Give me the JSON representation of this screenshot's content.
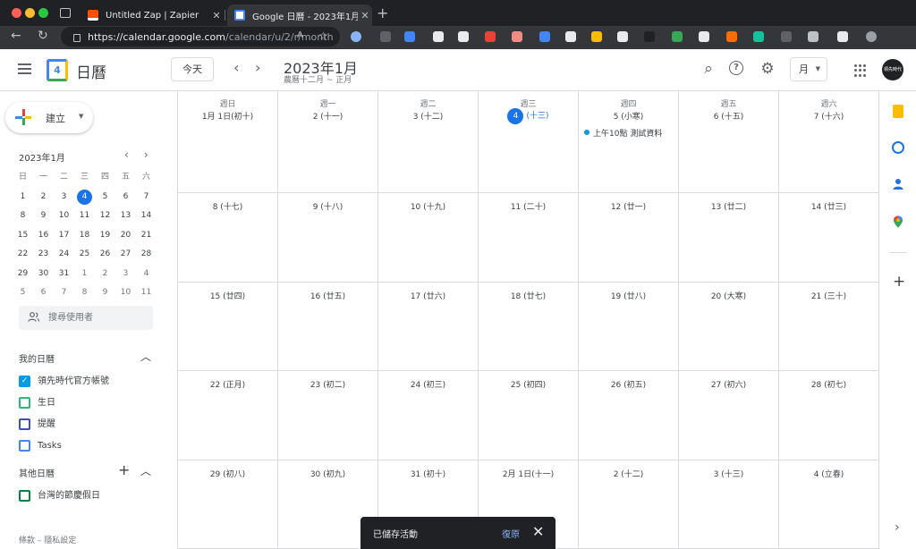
{
  "browser": {
    "tabs": [
      {
        "title": "Untitled Zap | Zapier",
        "active": false,
        "close": "✕"
      },
      {
        "title": "Google 日曆 - 2023年1月",
        "active": true,
        "close": "✕"
      }
    ],
    "new_tab": "+",
    "url_host": "https://calendar.google.com",
    "url_path": "/calendar/u/2/r/month",
    "nav": {
      "back": "←",
      "reload": "↻"
    },
    "omni_icons": {
      "read_aloud": "A",
      "favorite": "☆"
    },
    "extension_icons": [
      "profile-extension-icon",
      "extension-icon",
      "extension-icon",
      "notion-icon",
      "extension-icon",
      "extension-icon",
      "extension-icon",
      "translate-icon",
      "extension-icon",
      "extension-icon",
      "extension-icon",
      "extension-icon",
      "extension-icon",
      "extension-icon",
      "extension-icon",
      "grammarly-icon",
      "extension-icon",
      "puzzle-icon",
      "extension-icon",
      "profile-avatar"
    ]
  },
  "header": {
    "app_name": "日曆",
    "logo_num": "4",
    "today_btn": "今天",
    "prev": "‹",
    "next": "›",
    "month_title": "2023年1月",
    "lunar": "農曆十二月 ~ 正月",
    "view": "月",
    "avatar_text": "領先時代",
    "icons": {
      "search": "⌕",
      "help": "?",
      "settings": "⚙"
    }
  },
  "sidebar": {
    "create": "建立",
    "mini_month": "2023年1月",
    "mini_prev": "‹",
    "mini_next": "›",
    "weekdays": [
      "日",
      "一",
      "二",
      "三",
      "四",
      "五",
      "六"
    ],
    "mini_days": [
      {
        "d": "1",
        "o": false
      },
      {
        "d": "2",
        "o": false
      },
      {
        "d": "3",
        "o": false
      },
      {
        "d": "4",
        "o": false,
        "today": true
      },
      {
        "d": "5",
        "o": false
      },
      {
        "d": "6",
        "o": false
      },
      {
        "d": "7",
        "o": false
      },
      {
        "d": "8",
        "o": false
      },
      {
        "d": "9",
        "o": false
      },
      {
        "d": "10",
        "o": false
      },
      {
        "d": "11",
        "o": false
      },
      {
        "d": "12",
        "o": false
      },
      {
        "d": "13",
        "o": false
      },
      {
        "d": "14",
        "o": false
      },
      {
        "d": "15",
        "o": false
      },
      {
        "d": "16",
        "o": false
      },
      {
        "d": "17",
        "o": false
      },
      {
        "d": "18",
        "o": false
      },
      {
        "d": "19",
        "o": false
      },
      {
        "d": "20",
        "o": false
      },
      {
        "d": "21",
        "o": false
      },
      {
        "d": "22",
        "o": false
      },
      {
        "d": "23",
        "o": false
      },
      {
        "d": "24",
        "o": false
      },
      {
        "d": "25",
        "o": false
      },
      {
        "d": "26",
        "o": false
      },
      {
        "d": "27",
        "o": false
      },
      {
        "d": "28",
        "o": false
      },
      {
        "d": "29",
        "o": false
      },
      {
        "d": "30",
        "o": false
      },
      {
        "d": "31",
        "o": false
      },
      {
        "d": "1",
        "o": true
      },
      {
        "d": "2",
        "o": true
      },
      {
        "d": "3",
        "o": true
      },
      {
        "d": "4",
        "o": true
      },
      {
        "d": "5",
        "o": true
      },
      {
        "d": "6",
        "o": true
      },
      {
        "d": "7",
        "o": true
      },
      {
        "d": "8",
        "o": true
      },
      {
        "d": "9",
        "o": true
      },
      {
        "d": "10",
        "o": true
      },
      {
        "d": "11",
        "o": true
      }
    ],
    "search_people": "搜尋使用者",
    "my_calendars_title": "我的日曆",
    "my_calendars": [
      {
        "name": "領先時代官方帳號",
        "color": "#039be5",
        "checked": true
      },
      {
        "name": "生日",
        "color": "#33b679",
        "checked": false
      },
      {
        "name": "提醒",
        "color": "#3f51b5",
        "checked": false
      },
      {
        "name": "Tasks",
        "color": "#4285f4",
        "checked": false
      }
    ],
    "other_calendars_title": "其他日曆",
    "other_calendars": [
      {
        "name": "台灣的節慶假日",
        "color": "#0b8043",
        "checked": false
      }
    ],
    "footer": "條款 – 隱私設定"
  },
  "month": {
    "weekday_headers": [
      "週日",
      "週一",
      "週二",
      "週三",
      "週四",
      "週五",
      "週六"
    ],
    "weeks": [
      [
        {
          "label": "1月 1日(初十)"
        },
        {
          "label": "2 (十一)"
        },
        {
          "label": "3 (十二)"
        },
        {
          "day": "4",
          "lunar": "(十三)",
          "today": true
        },
        {
          "label": "5 (小寒)"
        },
        {
          "label": "6 (十五)"
        },
        {
          "label": "7 (十六)"
        }
      ],
      [
        {
          "label": "8 (十七)"
        },
        {
          "label": "9 (十八)"
        },
        {
          "label": "10 (十九)"
        },
        {
          "label": "11 (二十)"
        },
        {
          "label": "12 (廿一)"
        },
        {
          "label": "13 (廿二)"
        },
        {
          "label": "14 (廿三)"
        }
      ],
      [
        {
          "label": "15 (廿四)"
        },
        {
          "label": "16 (廿五)"
        },
        {
          "label": "17 (廿六)"
        },
        {
          "label": "18 (廿七)"
        },
        {
          "label": "19 (廿八)"
        },
        {
          "label": "20 (大寒)"
        },
        {
          "label": "21 (三十)"
        }
      ],
      [
        {
          "label": "22 (正月)"
        },
        {
          "label": "23 (初二)"
        },
        {
          "label": "24 (初三)"
        },
        {
          "label": "25 (初四)"
        },
        {
          "label": "26 (初五)"
        },
        {
          "label": "27 (初六)"
        },
        {
          "label": "28 (初七)"
        }
      ],
      [
        {
          "label": "29 (初八)"
        },
        {
          "label": "30 (初九)"
        },
        {
          "label": "31 (初十)"
        },
        {
          "label": "2月 1日(十一)"
        },
        {
          "label": "2 (十二)"
        },
        {
          "label": "3 (十三)"
        },
        {
          "label": "4 (立春)"
        }
      ]
    ],
    "events": [
      {
        "week": 0,
        "day": 4,
        "text": "上午10點 測試資料",
        "color": "#039be5"
      }
    ]
  },
  "side_panel": {
    "icons": [
      "keep-icon",
      "tasks-icon",
      "contacts-icon",
      "maps-icon"
    ],
    "add": "+",
    "expand": "›"
  },
  "snackbar": {
    "message": "已儲存活動",
    "action": "復原",
    "close": "✕"
  }
}
